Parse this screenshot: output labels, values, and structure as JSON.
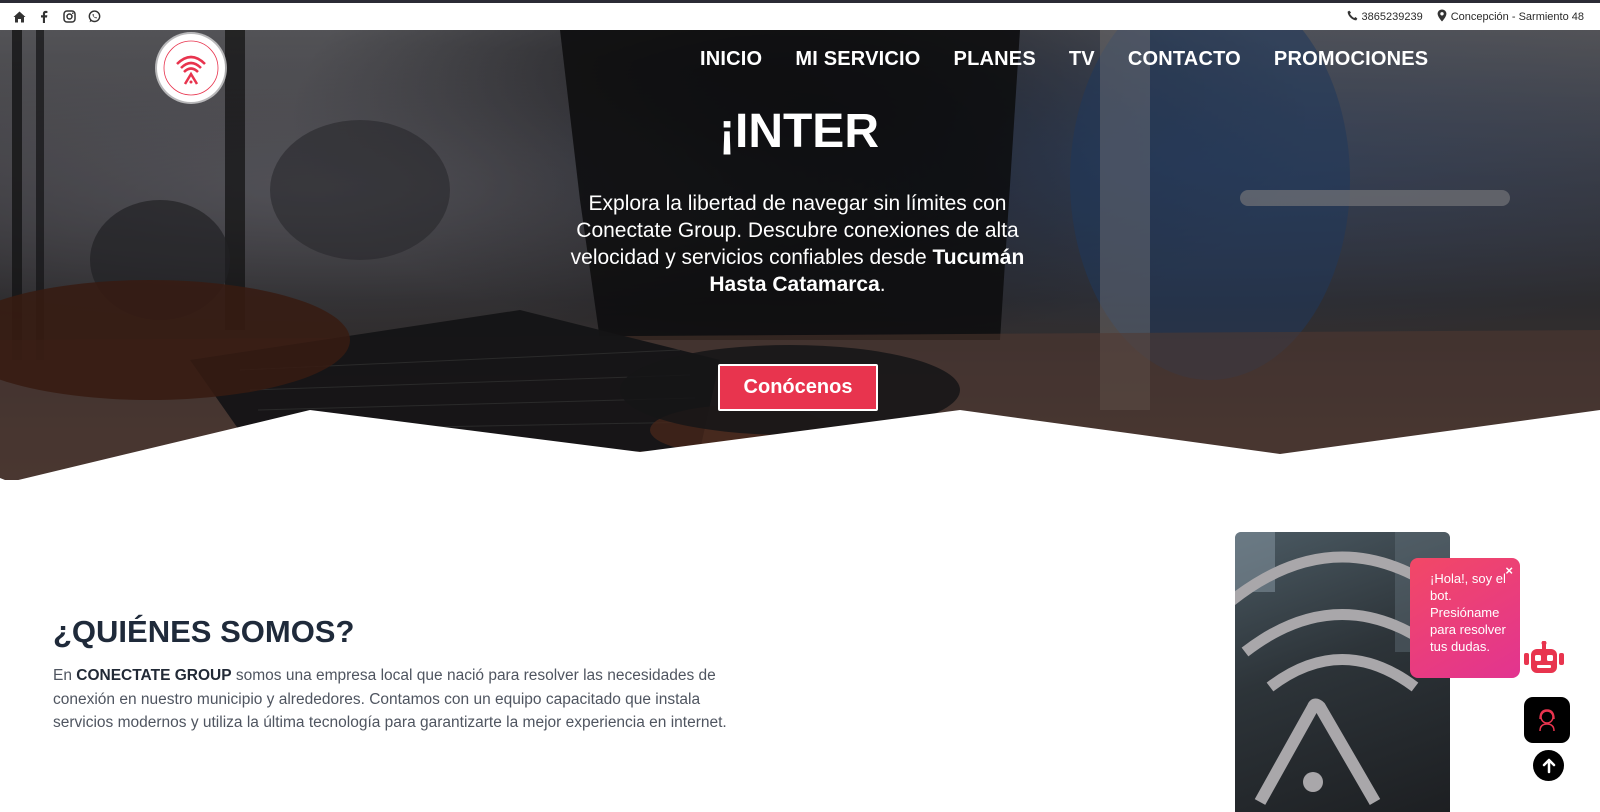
{
  "topbar": {
    "phone": "3865239239",
    "location": "Concepción - Sarmiento 48",
    "social_icons": [
      "home-icon",
      "facebook-icon",
      "instagram-icon",
      "whatsapp-icon"
    ]
  },
  "nav": {
    "items": [
      "INICIO",
      "MI SERVICIO",
      "PLANES",
      "TV",
      "CONTACTO",
      "PROMOCIONES"
    ]
  },
  "hero": {
    "title": "¡INTER",
    "text_1": "Explora la libertad de navegar sin límites con Conectate Group. Descubre conexiones de alta velocidad y servicios confiables desde ",
    "text_bold": "Tucumán Hasta Catamarca",
    "text_end": ".",
    "cta_label": "Conócenos"
  },
  "about": {
    "title": "¿QUIÉNES SOMOS?",
    "text_prefix": "En ",
    "text_bold": "CONECTATE GROUP",
    "text_rest": " somos una empresa local que nació para resolver las necesidades de conexión en nuestro municipio y alrededores. Contamos con un equipo capacitado que instala servicios modernos y utiliza la última tecnología para garantizarte la mejor experiencia en internet."
  },
  "chatbot": {
    "bubble_text": "¡Hola!, soy el bot. Presióname para resolver tus dudas.",
    "close_label": "×"
  },
  "colors": {
    "accent": "#e8344e",
    "bubble_pink": "#ef3f78",
    "heading": "#1f2a3a"
  }
}
